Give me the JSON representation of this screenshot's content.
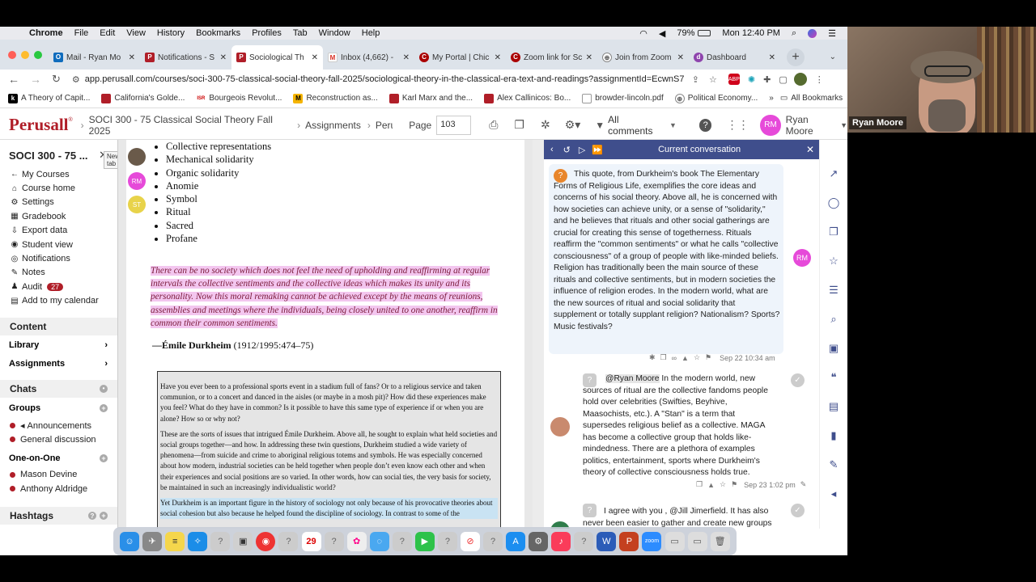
{
  "menubar": {
    "app": "Chrome",
    "items": [
      "File",
      "Edit",
      "View",
      "History",
      "Bookmarks",
      "Profiles",
      "Tab",
      "Window",
      "Help"
    ],
    "battery": "79%",
    "clock": "Mon 12:40 PM"
  },
  "tabs": [
    {
      "label": "Mail - Ryan Mo"
    },
    {
      "label": "Notifications - S"
    },
    {
      "label": "Sociological Th"
    },
    {
      "label": "Inbox (4,662) -"
    },
    {
      "label": "My Portal | Chic"
    },
    {
      "label": "Zoom link for Sc"
    },
    {
      "label": "Join from Zoom"
    },
    {
      "label": "Dashboard"
    }
  ],
  "address": {
    "url": "app.perusall.com/courses/soci-300-75-classical-social-theory-fall-2025/sociological-theory-in-the-classical-era-text-and-readings?assignmentId=EcwnS7..."
  },
  "bookmarks": [
    "A Theory of Capit...",
    "California's Golde...",
    "Bourgeois Revolut...",
    "Reconstruction as...",
    "Karl Marx and the...",
    "Alex Callinicos: Bo...",
    "browder-lincoln.pdf",
    "Political Economy..."
  ],
  "bookmarks_all": "All Bookmarks",
  "appbar": {
    "logo": "Perusall",
    "course": "SOCI 300 - 75 Classical Social Theory Fall 2025",
    "sep1": "Assignments",
    "sep2": "Peru",
    "page_label": "Page",
    "page_value": "103",
    "filter": "All comments",
    "user_initials": "RM",
    "user_name": "Ryan Moore"
  },
  "sidebar": {
    "course_title": "SOCI 300 - 75 ...",
    "tooltip": "New tab",
    "nav": [
      {
        "label": "My Courses",
        "icon": "←"
      },
      {
        "label": "Course home",
        "icon": "⌂"
      },
      {
        "label": "Settings",
        "icon": "⚙"
      },
      {
        "label": "Gradebook",
        "icon": "▦"
      },
      {
        "label": "Export data",
        "icon": "⇩"
      },
      {
        "label": "Student view",
        "icon": "◉"
      },
      {
        "label": "Notifications",
        "icon": "◎"
      },
      {
        "label": "Notes",
        "icon": "✎"
      },
      {
        "label": "Audit",
        "icon": "♟"
      },
      {
        "label": "Add to my calendar",
        "icon": "▤"
      }
    ],
    "audit_badge": "27",
    "content_head": "Content",
    "library": "Library",
    "assignments": "Assignments",
    "chats_head": "Chats",
    "groups": "Groups",
    "group_items": [
      "Announcements",
      "General discussion"
    ],
    "one_on_one": "One-on-One",
    "people": [
      "Mason Devine",
      "Anthony Aldridge"
    ],
    "hashtags": "Hashtags"
  },
  "doc": {
    "bullets": [
      "Collective representations",
      "Mechanical solidarity",
      "Organic solidarity",
      "Anomie",
      "Symbol",
      "Ritual",
      "Sacred",
      "Profane"
    ],
    "quote": "There can be no society which does not feel the need of upholding and reaffirming at regular intervals the collective sentiments and the collective ideas which makes its unity and its personality. Now this moral remaking cannot be achieved except by the means of reunions, assemblies and meetings where the individuals, being closely united to one another, reaffirm in common their common sentiments.",
    "attribution_name": "—Émile Durkheim",
    "attribution_cite": " (1912/1995:474–75)",
    "box_p1": "Have you ever been to a professional sports event in a stadium full of fans? Or to a religious service and taken communion, or to a concert and danced in the aisles (or maybe in a mosh pit)? How did these experiences make you feel? What do they have in common? Is it possible to have this same type of experience if or when you are alone? How so or why not?",
    "box_p2": "These are the sorts of issues that intrigued Émile Durkheim. Above all, he sought to explain what held societies and social groups together—and how. In addressing these twin questions, Durkheim studied a wide variety of phenomena—from suicide and crime to aboriginal religious totems and symbols. He was especially concerned about how modern, industrial societies can be held together when people don’t even know each other and when their experiences and social positions are so varied. In other words, how can social ties, the very basis for society, be maintained in such an increasingly individualistic world?",
    "box_p3": "Yet Durkheim is an important figure in the history of sociology not only because of his provocative theories about social cohesion but also because he helped found the discipline of sociology. In contrast to some of the"
  },
  "margin_avatars": [
    "RM",
    "ST"
  ],
  "convo": {
    "title": "Current conversation",
    "c1": "This quote, from Durkheim's book The Elementary Forms of Religious Life, exemplifies the core ideas and concerns of his social theory. Above all, he is concerned with how societies can achieve unity, or a sense of \"solidarity,\" and he believes that rituals and other social gatherings are crucial for creating this sense of togetherness. Rituals reaffirm the \"common sentiments\" or what he calls \"collective consciousness\" of a group of people with like-minded beliefs. Religion has traditionally been the main source of these rituals and collective sentiments, but in modern societies the influence of religion erodes. In the modern world, what are the new sources of ritual and social solidarity that supplement or totally supplant religion? Nationalism? Sports? Music festivals?",
    "c1_author": "RM",
    "c1_time": "Sep 22 10:34 am",
    "c2_mention": "@Ryan Moore",
    "c2": " In the modern world, new sources of ritual are the collective fandoms people hold over celebrities (Swifties, Beyhive, Maasochists, etc.). A \"Stan\" is a term that supersedes religious belief as a collective. MAGA has become a collective group that holds like-mindedness. There are a plethora of examples politics, entertainment, sports where Durkheim's theory of collective consciousness holds true.",
    "c2_time": "Sep 23 1:02 pm",
    "c3": "I agree with you , @Jill Jimerfield. It has also never been easier to gather and create new groups with"
  },
  "webcam": {
    "name": "Ryan Moore"
  },
  "dock": {
    "date": "29"
  },
  "colors": {
    "brand": "#b01e28",
    "accent": "#3f4e8c",
    "highlight_pink": "#f3c6ef",
    "highlight_blue": "#c9e3f3",
    "rm_avatar": "#e64ad9"
  }
}
